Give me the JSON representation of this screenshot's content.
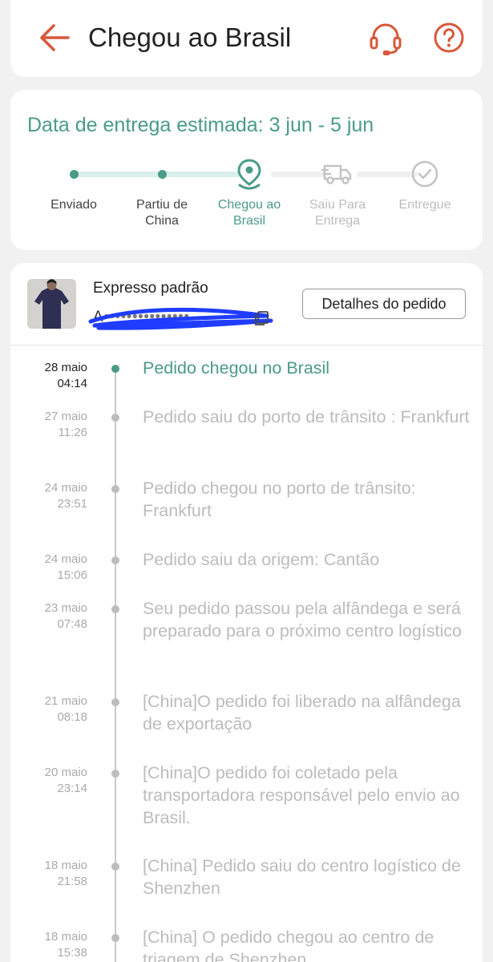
{
  "header": {
    "title": "Chegou ao Brasil",
    "back_icon": "arrow-left-icon",
    "support_icon": "headset-icon",
    "help_icon": "question-circle-icon",
    "accent_color": "#d9573a"
  },
  "progress": {
    "eta": "Data de entrega estimada: 3 jun - 5 jun",
    "accent_color": "#4a9b87",
    "steps": [
      {
        "label": "Enviado",
        "state": "done"
      },
      {
        "label": "Partiu de China",
        "state": "done"
      },
      {
        "label": "Chegou ao Brasil",
        "state": "current",
        "icon": "location-pin-icon"
      },
      {
        "label": "Saiu Para Entrega",
        "state": "future",
        "icon": "truck-icon"
      },
      {
        "label": "Entregue",
        "state": "future",
        "icon": "check-circle-icon"
      }
    ]
  },
  "shipment": {
    "carrier": "Expresso padrão",
    "tracking_code_visible": "A",
    "tracking_code_redacted": true,
    "details_button": "Detalhes do pedido",
    "copy_icon": "copy-icon"
  },
  "events": [
    {
      "date": "28 maio",
      "time": "04:14",
      "text": "Pedido chegou no Brasil",
      "current": true
    },
    {
      "date": "27 maio",
      "time": "11:26",
      "text": "Pedido saiu do porto de trânsito : Frankfurt",
      "current": false
    },
    {
      "date": "24 maio",
      "time": "23:51",
      "text": "Pedido chegou no porto de trânsito: Frankfurt",
      "current": false
    },
    {
      "date": "24 maio",
      "time": "15:06",
      "text": "Pedido saiu da origem: Cantão",
      "current": false
    },
    {
      "date": "23 maio",
      "time": "07:48",
      "text": "Seu pedido passou pela alfândega e será preparado para o próximo centro logístico",
      "current": false
    },
    {
      "date": "21 maio",
      "time": "08:18",
      "text": "[China]O pedido foi liberado na alfândega de exportação",
      "current": false
    },
    {
      "date": "20 maio",
      "time": "23:14",
      "text": "[China]O pedido foi coletado pela transportadora responsável pelo envio ao Brasil.",
      "current": false
    },
    {
      "date": "18 maio",
      "time": "21:58",
      "text": "[China] Pedido saiu do centro logístico de Shenzhen",
      "current": false
    },
    {
      "date": "18 maio",
      "time": "15:38",
      "text": "[China] O pedido chegou ao centro de triagem de Shenzhen",
      "current": false
    }
  ]
}
